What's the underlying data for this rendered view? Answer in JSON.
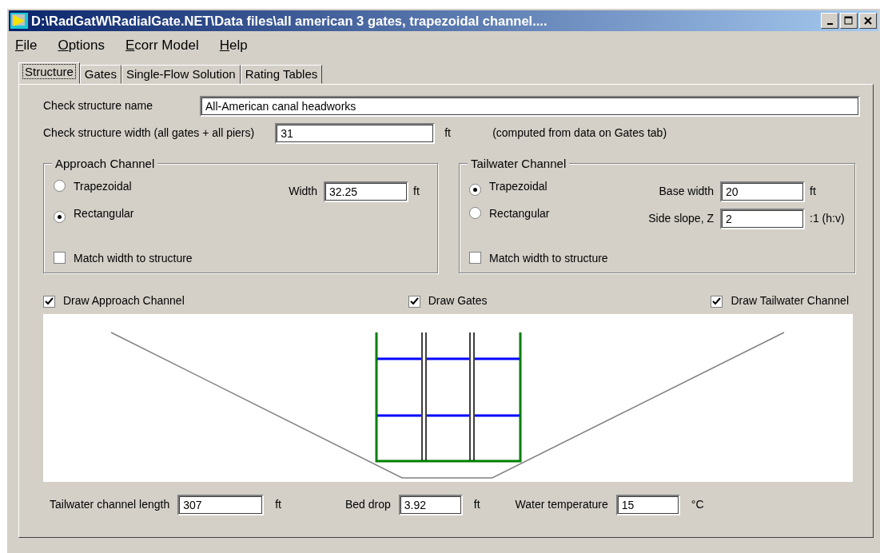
{
  "window": {
    "title": "D:\\RadGatW\\RadialGate.NET\\Data files\\all american 3 gates, trapezoidal channel...."
  },
  "menu": [
    "File",
    "Options",
    "Ecorr Model",
    "Help"
  ],
  "tabs": [
    {
      "label": "Structure",
      "selected": true
    },
    {
      "label": "Gates",
      "selected": false
    },
    {
      "label": "Single-Flow Solution",
      "selected": false
    },
    {
      "label": "Rating Tables",
      "selected": false
    }
  ],
  "structure_name": {
    "label": "Check structure name",
    "value": "All-American canal headworks"
  },
  "structure_width": {
    "label": "Check structure width (all gates + all piers)",
    "value": "31",
    "unit": "ft",
    "note": "(computed from data on Gates tab)"
  },
  "approach_channel": {
    "title": "Approach Channel",
    "shapes": [
      {
        "label": "Trapezoidal",
        "selected": false
      },
      {
        "label": "Rectangular",
        "selected": true
      }
    ],
    "fields": [
      {
        "label": "Width",
        "value": "32.25",
        "unit": "ft"
      }
    ],
    "match": {
      "label": "Match width to structure",
      "checked": false
    }
  },
  "tailwater_channel": {
    "title": "Tailwater Channel",
    "shapes": [
      {
        "label": "Trapezoidal",
        "selected": true
      },
      {
        "label": "Rectangular",
        "selected": false
      }
    ],
    "fields": [
      {
        "label": "Base width",
        "value": "20",
        "unit": "ft"
      },
      {
        "label": "Side slope, Z",
        "value": "2",
        "unit": ":1 (h:v)"
      }
    ],
    "match": {
      "label": "Match width to structure",
      "checked": false
    }
  },
  "draw_options": [
    {
      "label": "Draw Approach Channel",
      "checked": true
    },
    {
      "label": "Draw Gates",
      "checked": true
    },
    {
      "label": "Draw Tailwater Channel",
      "checked": true
    }
  ],
  "bottom_fields": [
    {
      "label": "Tailwater channel length",
      "value": "307",
      "unit": "ft"
    },
    {
      "label": "Bed drop",
      "value": "3.92",
      "unit": "ft"
    },
    {
      "label": "Water temperature",
      "value": "15",
      "unit": "°C"
    }
  ]
}
